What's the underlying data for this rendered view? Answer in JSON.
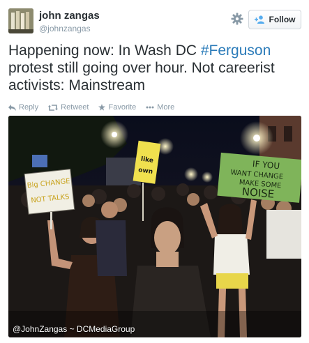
{
  "user": {
    "name": "john zangas",
    "handle": "@johnzangas"
  },
  "follow_button": {
    "label": "Follow"
  },
  "tweet": {
    "text_before": "Happening now: In Wash DC ",
    "hashtag": "#Ferguson",
    "text_after": " protest still going over hour. Not careerist activists: Mainstream"
  },
  "actions": {
    "reply": "Reply",
    "retweet": "Retweet",
    "favorite": "Favorite",
    "more": "More"
  },
  "photo": {
    "credit": "@JohnZangas ~ DCMediaGroup",
    "signs": {
      "left_line1": "Big CHANGE",
      "left_line2": "NOT TALKS",
      "center_line1": "like",
      "center_line2": "own",
      "right_line1": "IF YOU",
      "right_line2": "WANT CHANGE",
      "right_line3": "MAKE SOME",
      "right_line4": "NOISE"
    }
  },
  "colors": {
    "link": "#2b7bb9",
    "text": "#292f33",
    "muted": "#8899a6",
    "follow_icon": "#55acee"
  },
  "icons": [
    "settings-gear-icon",
    "follow-person-icon",
    "reply-icon",
    "retweet-icon",
    "favorite-star-icon",
    "more-icon"
  ]
}
